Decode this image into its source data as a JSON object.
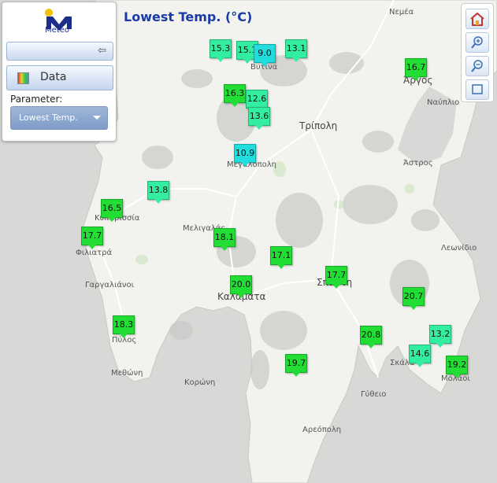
{
  "title": "Lowest Temp. (°C)",
  "panel": {
    "logo_text": "Meteo",
    "data_label": "Data",
    "parameter_label": "Parameter:",
    "parameter_value": "Lowest Temp."
  },
  "colors": {
    "sea": "#d9d9d7",
    "land": "#f2f2ef",
    "marker_hot": "#22dd33",
    "marker_mild": "#33eea0",
    "marker_cool": "#22dddd"
  },
  "places": [
    {
      "id": "nemea",
      "name": "Νεμέα"
    },
    {
      "id": "vytina",
      "name": "Βυτίνα"
    },
    {
      "id": "argos",
      "name": "Άργος"
    },
    {
      "id": "nafplio",
      "name": "Ναύπλιο"
    },
    {
      "id": "tripoli",
      "name": "Τρίπολη"
    },
    {
      "id": "astros",
      "name": "Άστρος"
    },
    {
      "id": "megalopoli",
      "name": "Μεγαλόπολη"
    },
    {
      "id": "kyparissia",
      "name": "Κυπαρισσία"
    },
    {
      "id": "meligalas",
      "name": "Μελιγαλάς"
    },
    {
      "id": "filiatra",
      "name": "Φιλιατρά"
    },
    {
      "id": "leonidio",
      "name": "Λεωνίδιο"
    },
    {
      "id": "sparti",
      "name": "Σπάρτη"
    },
    {
      "id": "gargaliani",
      "name": "Γαργαλιάνοι"
    },
    {
      "id": "kalamata",
      "name": "Καλαμάτα"
    },
    {
      "id": "pylos",
      "name": "Πύλος"
    },
    {
      "id": "skala",
      "name": "Σκάλα"
    },
    {
      "id": "methoni",
      "name": "Μεθώνη"
    },
    {
      "id": "koroni",
      "name": "Κορώνη"
    },
    {
      "id": "molaoi",
      "name": "Μολάοι"
    },
    {
      "id": "gytheio",
      "name": "Γύθειο"
    },
    {
      "id": "areopoli",
      "name": "Αρεόπολη"
    }
  ],
  "stations": [
    {
      "value": "15.3",
      "tone": "mild"
    },
    {
      "value": "15.1",
      "tone": "mild"
    },
    {
      "value": "9.0",
      "tone": "cool"
    },
    {
      "value": "13.1",
      "tone": "mild"
    },
    {
      "value": "16.7",
      "tone": "hot"
    },
    {
      "value": "16.3",
      "tone": "hot"
    },
    {
      "value": "12.6",
      "tone": "mild"
    },
    {
      "value": "13.6",
      "tone": "mild"
    },
    {
      "value": "10.9",
      "tone": "cool"
    },
    {
      "value": "13.8",
      "tone": "mild"
    },
    {
      "value": "16.5",
      "tone": "hot"
    },
    {
      "value": "17.7",
      "tone": "hot"
    },
    {
      "value": "18.1",
      "tone": "hot"
    },
    {
      "value": "17.1",
      "tone": "hot"
    },
    {
      "value": "20.0",
      "tone": "hot"
    },
    {
      "value": "17.7",
      "tone": "hot"
    },
    {
      "value": "20.7",
      "tone": "hot"
    },
    {
      "value": "18.3",
      "tone": "hot"
    },
    {
      "value": "20.8",
      "tone": "hot"
    },
    {
      "value": "13.2",
      "tone": "mild"
    },
    {
      "value": "14.6",
      "tone": "mild"
    },
    {
      "value": "19.2",
      "tone": "hot"
    },
    {
      "value": "19.7",
      "tone": "hot"
    }
  ]
}
